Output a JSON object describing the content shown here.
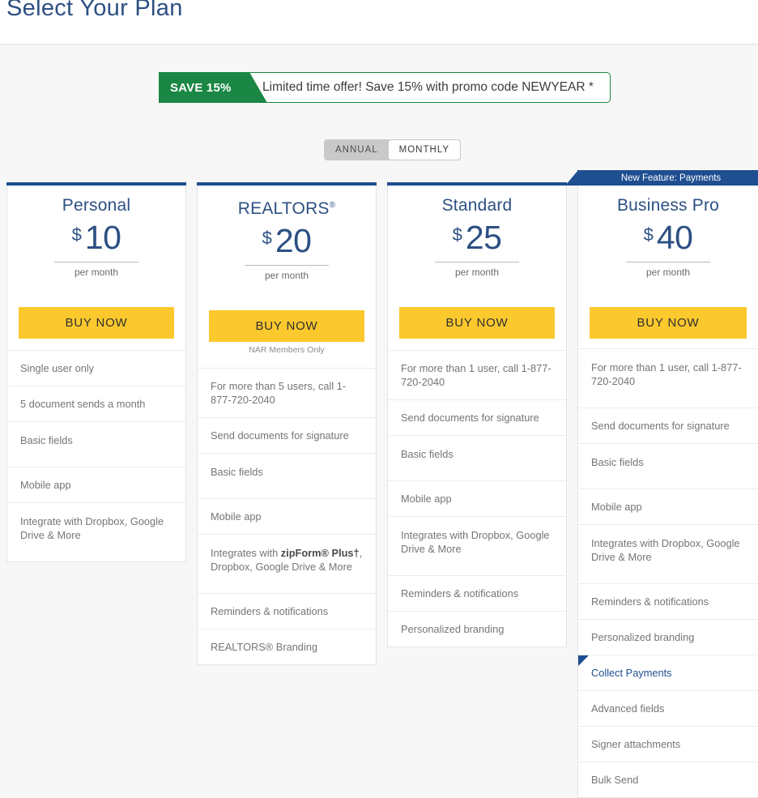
{
  "page": {
    "title": "Select Your Plan",
    "accent_blue": "#1f4e91",
    "title_blue": "#2d5083",
    "promo_green": "#1a8744",
    "buy_yellow": "#fbc82e",
    "background": "#f7f7f7"
  },
  "promo": {
    "tag": "SAVE 15%",
    "message": "Limited time offer! Save 15% with promo code NEWYEAR *"
  },
  "billing_toggle": {
    "options": [
      {
        "label": "ANNUAL",
        "selected": false
      },
      {
        "label": "MONTHLY",
        "selected": true
      }
    ]
  },
  "plans": [
    {
      "name": "Personal",
      "name_sup": "",
      "currency": "$",
      "price": "10",
      "period": "per month",
      "cta": "BUY NOW",
      "note": "",
      "ribbon": "",
      "features": [
        {
          "text": "Single user only"
        },
        {
          "text": "5 document sends a month"
        },
        {
          "text": "Basic fields"
        },
        {
          "text": "Mobile app"
        },
        {
          "text": "Integrate with Dropbox, Google Drive & More"
        }
      ]
    },
    {
      "name": "REALTORS",
      "name_sup": "®",
      "currency": "$",
      "price": "20",
      "period": "per month",
      "cta": "BUY NOW",
      "note": "NAR Members Only",
      "ribbon": "",
      "features": [
        {
          "text": "For more than 5 users, call 1-877-720-2040"
        },
        {
          "text": "Send documents for signature"
        },
        {
          "text": "Basic fields"
        },
        {
          "text": "Mobile app"
        },
        {
          "text": "Integrates with zipForm® Plus†, Dropbox, Google Drive & More",
          "bold_part": "zipForm® Plus†"
        },
        {
          "text": "Reminders & notifications"
        },
        {
          "text": "REALTORS® Branding"
        }
      ]
    },
    {
      "name": "Standard",
      "name_sup": "",
      "currency": "$",
      "price": "25",
      "period": "per month",
      "cta": "BUY NOW",
      "note": "",
      "ribbon": "",
      "features": [
        {
          "text": "For more than 1 user, call 1-877-720-2040"
        },
        {
          "text": "Send documents for signature"
        },
        {
          "text": "Basic fields"
        },
        {
          "text": "Mobile app"
        },
        {
          "text": "Integrates with Dropbox, Google Drive & More"
        },
        {
          "text": "Reminders & notifications"
        },
        {
          "text": "Personalized branding"
        }
      ]
    },
    {
      "name": "Business Pro",
      "name_sup": "",
      "currency": "$",
      "price": "40",
      "period": "per month",
      "cta": "BUY NOW",
      "note": "",
      "ribbon": "New Feature: Payments",
      "features": [
        {
          "text": "For more than 1 user, call 1-877-720-2040"
        },
        {
          "text": "Send documents for signature"
        },
        {
          "text": "Basic fields"
        },
        {
          "text": "Mobile app"
        },
        {
          "text": "Integrates with Dropbox, Google Drive & More"
        },
        {
          "text": "Reminders & notifications"
        },
        {
          "text": "Personalized branding"
        },
        {
          "text": "Collect Payments",
          "highlight": true
        },
        {
          "text": "Advanced fields"
        },
        {
          "text": "Signer attachments"
        },
        {
          "text": "Bulk Send"
        }
      ]
    }
  ]
}
